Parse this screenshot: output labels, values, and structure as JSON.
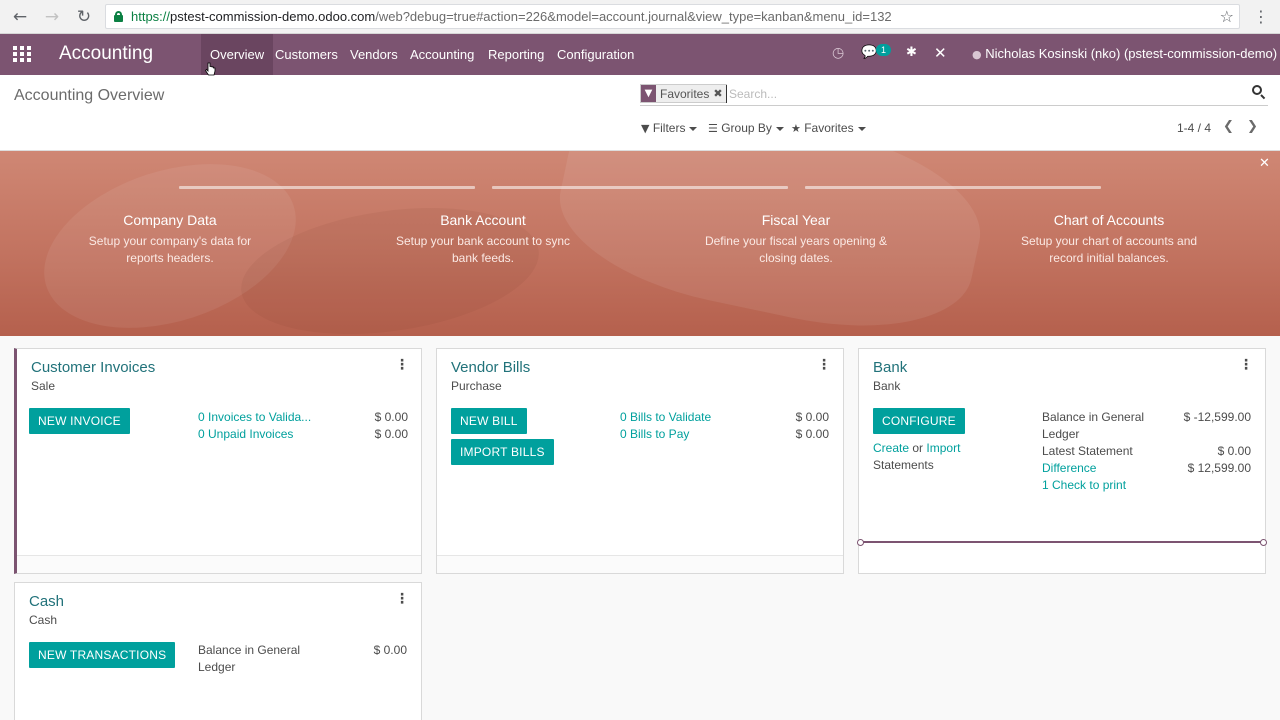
{
  "browser": {
    "back_glyph": "←",
    "forward_glyph": "→",
    "reload_glyph": "↻",
    "url_scheme": "https://",
    "url_host": "pstest-commission-demo.odoo.com",
    "url_path": "/web?debug=true#action=226&model=account.journal&view_type=kanban&menu_id=132",
    "star_glyph": "☆",
    "menu_glyph": "⋮"
  },
  "navbar": {
    "app_title": "Accounting",
    "menu": [
      {
        "label": "Overview"
      },
      {
        "label": "Customers"
      },
      {
        "label": "Vendors"
      },
      {
        "label": "Accounting"
      },
      {
        "label": "Reporting"
      },
      {
        "label": "Configuration"
      }
    ],
    "activity_glyph": "◷",
    "chat_glyph": "💬",
    "chat_badge": "1",
    "debug_glyph": "✱",
    "tools_glyph": "✕",
    "user_label": "Nicholas Kosinski (nko) (pstest-commission-demo)",
    "color": "#7c5471"
  },
  "control_panel": {
    "title": "Accounting Overview",
    "facet_label": "Favorites",
    "facet_icon": "▼",
    "facet_remove": "✖",
    "search_placeholder": "Search...",
    "filters_label": "Filters",
    "groupby_label": "Group By",
    "favorites_label": "Favorites",
    "filter_glyph": "▼",
    "groupby_glyph": "☰",
    "favorites_glyph": "★",
    "pager": "1-4 / 4",
    "prev_glyph": "❮",
    "next_glyph": "❯"
  },
  "banner": {
    "close_glyph": "✕",
    "steps": [
      {
        "title": "Company Data",
        "desc": "Setup your company's data for reports headers."
      },
      {
        "title": "Bank Account",
        "desc": "Setup your bank account to sync bank feeds."
      },
      {
        "title": "Fiscal Year",
        "desc": "Define your fiscal years opening & closing dates."
      },
      {
        "title": "Chart of Accounts",
        "desc": "Setup your chart of accounts and record initial balances."
      }
    ]
  },
  "cards": {
    "menu_glyph": "⋮",
    "customer_invoices": {
      "title": "Customer Invoices",
      "type": "Sale",
      "button": "New Invoice",
      "rows": [
        {
          "label": "0 Invoices to Valida...",
          "amount": "$ 0.00"
        },
        {
          "label": "0 Unpaid Invoices",
          "amount": "$ 0.00"
        }
      ]
    },
    "vendor_bills": {
      "title": "Vendor Bills",
      "type": "Purchase",
      "button_new": "New Bill",
      "button_import": "Import Bills",
      "rows": [
        {
          "label": "0 Bills to Validate",
          "amount": "$ 0.00"
        },
        {
          "label": "0 Bills to Pay",
          "amount": "$ 0.00"
        }
      ]
    },
    "bank": {
      "title": "Bank",
      "type": "Bank",
      "button": "Configure",
      "create_link": "Create",
      "or_text": "or",
      "import_link": "Import",
      "statements_text": "Statements",
      "balance_label": "Balance in General Ledger",
      "balance_amount": "$ -12,599.00",
      "latest_label": "Latest Statement",
      "latest_amount": "$ 0.00",
      "difference_label": "Difference",
      "difference_amount": "$ 12,599.00",
      "check_link": "1 Check to print"
    },
    "cash": {
      "title": "Cash",
      "type": "Cash",
      "button": "New Transactions",
      "balance_label": "Balance in General Ledger",
      "balance_amount": "$ 0.00"
    }
  },
  "colors": {
    "brand": "#7c5471",
    "accent": "#00a09d",
    "title_link": "#21727a"
  }
}
